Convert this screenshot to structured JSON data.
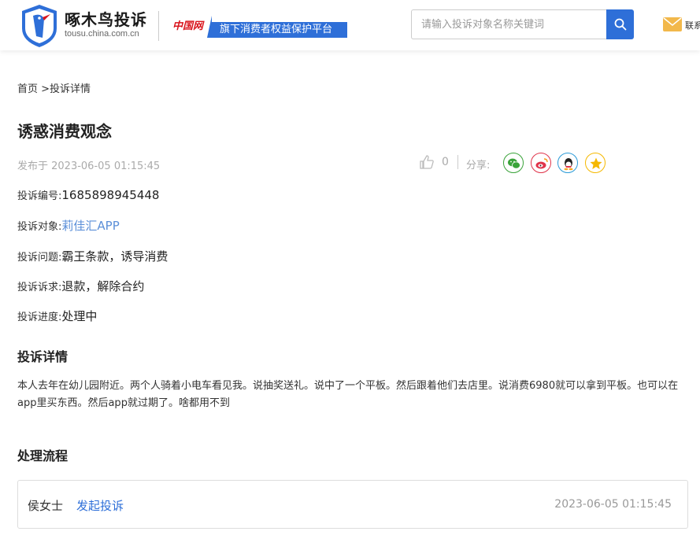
{
  "header": {
    "brand_title": "啄木鸟投诉",
    "brand_domain": "tousu.china.com.cn",
    "partner_logo_text": "中国网",
    "partner_tag": "旗下消费者权益保护平台",
    "search_placeholder": "请输入投诉对象名称关键词",
    "contact_label": "联系"
  },
  "breadcrumb": "首页 >投诉详情",
  "complaint": {
    "title": "诱惑消费观念",
    "published": "发布于 2023-06-05 01:15:45",
    "likes": "0",
    "share_label": "分享:",
    "share_icons": [
      "wechat-icon",
      "weibo-icon",
      "qq-icon",
      "qzone-icon"
    ],
    "fields": [
      {
        "label": "投诉编号:",
        "value": "1685898945448"
      },
      {
        "label": "投诉对象:",
        "value": "莉佳汇APP"
      },
      {
        "label": "投诉问题:",
        "value": "霸王条款，诱导消费"
      },
      {
        "label": "投诉诉求:",
        "value": "退款，解除合约"
      },
      {
        "label": "投诉进度:",
        "value": "处理中"
      }
    ]
  },
  "details": {
    "title": "投诉详情",
    "text": "本人去年在幼儿园附近。两个人骑着小电车看见我。说抽奖送礼。说中了一个平板。然后跟着他们去店里。说消费6980就可以拿到平板。也可以在app里买东西。然后app就过期了。啥都用不到"
  },
  "process": {
    "title": "处理流程",
    "items": [
      {
        "user": "侯女士",
        "action": "发起投诉",
        "time": "2023-06-05 01:15:45"
      }
    ]
  },
  "colors": {
    "accent": "#2e6fd8",
    "link": "#5b8fd8",
    "brand_red": "#d9141c"
  }
}
